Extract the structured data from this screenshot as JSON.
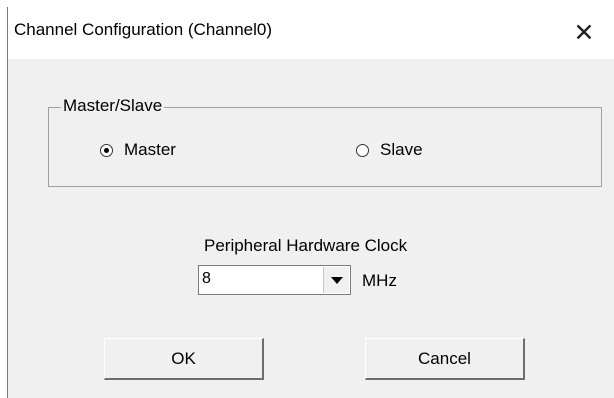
{
  "dialog": {
    "title": "Channel Configuration (Channel0)",
    "close_symbol": "✕"
  },
  "master_slave": {
    "group_label": "Master/Slave",
    "options": [
      {
        "label": "Master",
        "selected": true
      },
      {
        "label": "Slave",
        "selected": false
      }
    ]
  },
  "clock": {
    "label": "Peripheral Hardware Clock",
    "value": "8",
    "unit": "MHz"
  },
  "buttons": {
    "ok": "OK",
    "cancel": "Cancel"
  },
  "icons": {
    "close": "close-icon",
    "dropdown": "chevron-down-icon",
    "radio_selected": "radio-selected-icon",
    "radio_unselected": "radio-unselected-icon"
  },
  "colors": {
    "dialog_background": "#f0f0f0",
    "titlebar_background": "#ffffff",
    "border": "#a0a0a0",
    "text": "#000000"
  }
}
